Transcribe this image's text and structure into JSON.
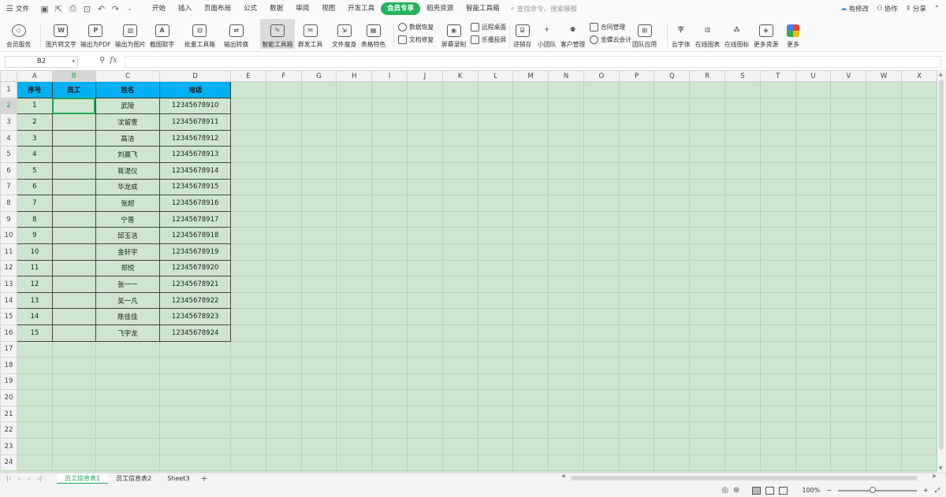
{
  "menubar": {
    "file_label": "文件",
    "tabs": [
      {
        "label": "开始"
      },
      {
        "label": "插入"
      },
      {
        "label": "页面布局"
      },
      {
        "label": "公式"
      },
      {
        "label": "数据"
      },
      {
        "label": "审阅"
      },
      {
        "label": "视图"
      },
      {
        "label": "开发工具"
      },
      {
        "label": "会员专享",
        "active": true
      },
      {
        "label": "稻壳资源"
      },
      {
        "label": "智能工具箱"
      }
    ],
    "search_placeholder": "查找命令、搜索模板",
    "right": {
      "unsaved": "有修改",
      "collab": "协作",
      "share": "分享"
    }
  },
  "toolbar": {
    "member_service": "会员服务",
    "pic_to_text": "图片转文字",
    "export_pdf": "输出为PDF",
    "export_image": "输出为图片",
    "screenshot_ocr": "截图取字",
    "batch_toolbox": "批量工具箱",
    "export_convert": "输出转换",
    "smart_toolbox": "智能工具箱",
    "mass_send": "群发工具",
    "file_slim": "文件瘦身",
    "table_feature": "表格特色",
    "data_recovery": "数据恢复",
    "doc_repair": "文档修复",
    "screen_record": "屏幕录制",
    "remote_desktop": "远程桌面",
    "cast_screen": "乐播投屏",
    "inventory": "进销存",
    "small_team": "小团队",
    "crm": "客户管理",
    "contract_mgmt": "合同管理",
    "kingdee_cloud": "金蝶云会计",
    "team_apps": "团队应用",
    "cloud_font": "云字体",
    "online_chart": "在线图表",
    "online_icon": "在线图标",
    "more_resources": "更多资源",
    "more": "更多"
  },
  "formula_bar": {
    "cell_ref": "B2",
    "fx_label": "fx",
    "value": ""
  },
  "grid": {
    "columns": [
      "A",
      "B",
      "C",
      "D",
      "E",
      "F",
      "G",
      "H",
      "I",
      "J",
      "K",
      "L",
      "M",
      "N",
      "O",
      "P",
      "Q",
      "R",
      "S",
      "T",
      "U",
      "V",
      "W",
      "X"
    ],
    "selected_column": "B",
    "selected_row": 2,
    "row_count": 24,
    "header_row": [
      "序号",
      "员工",
      "姓名",
      "电话"
    ],
    "rows": [
      [
        "1",
        "",
        "武陵",
        "12345678910"
      ],
      [
        "2",
        "",
        "沈留壹",
        "12345678911"
      ],
      [
        "3",
        "",
        "高洁",
        "12345678912"
      ],
      [
        "4",
        "",
        "刘晨飞",
        "12345678913"
      ],
      [
        "5",
        "",
        "蒋湜仪",
        "12345678914"
      ],
      [
        "6",
        "",
        "华龙成",
        "12345678915"
      ],
      [
        "7",
        "",
        "张超",
        "12345678916"
      ],
      [
        "8",
        "",
        "宁晋",
        "12345678917"
      ],
      [
        "9",
        "",
        "邱玉洁",
        "12345678918"
      ],
      [
        "10",
        "",
        "金轩宇",
        "12345678919"
      ],
      [
        "11",
        "",
        "郑悦",
        "12345678920"
      ],
      [
        "12",
        "",
        "张一一",
        "12345678921"
      ],
      [
        "13",
        "",
        "吴一凡",
        "12345678922"
      ],
      [
        "14",
        "",
        "陈佳佳",
        "12345678923"
      ],
      [
        "15",
        "",
        "飞宇龙",
        "12345678924"
      ]
    ]
  },
  "sheets": [
    {
      "label": "员工信息表1",
      "active": true
    },
    {
      "label": "员工信息表2"
    },
    {
      "label": "Sheet3"
    }
  ],
  "status": {
    "zoom": "100%",
    "zoom_minus": "−",
    "zoom_plus": "+"
  },
  "colors": {
    "accent": "#23b35c",
    "sheet_bg": "#cde6cd",
    "header_fill": "#00b0f0"
  }
}
